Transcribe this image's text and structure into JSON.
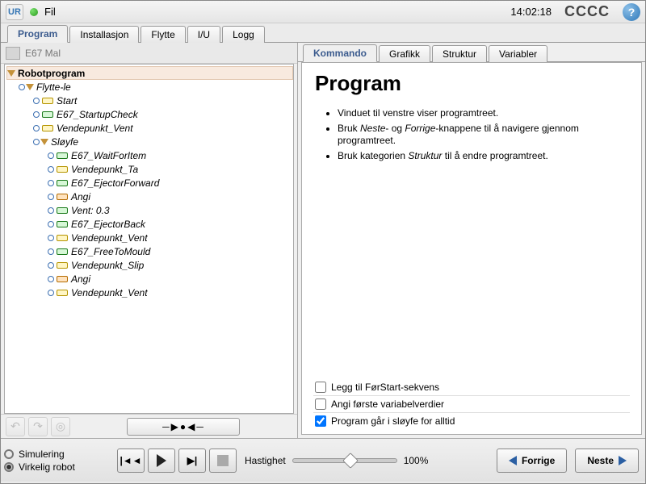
{
  "menubar": {
    "logo_text": "UR",
    "file_menu": "Fil",
    "clock": "14:02:18",
    "cccc": "CCCC",
    "help": "?"
  },
  "main_tabs": [
    {
      "label": "Program",
      "active": true
    },
    {
      "label": "Installasjon",
      "active": false
    },
    {
      "label": "Flytte",
      "active": false
    },
    {
      "label": "I/U",
      "active": false
    },
    {
      "label": "Logg",
      "active": false
    }
  ],
  "file": {
    "name": "E67 Mal"
  },
  "tree": {
    "root": "Robotprogram",
    "nodes": [
      {
        "depth": 1,
        "toggle": true,
        "tri": true,
        "ico": null,
        "label": "Flytte-le"
      },
      {
        "depth": 2,
        "toggle": false,
        "ico": "yellow",
        "label": "Start"
      },
      {
        "depth": 2,
        "toggle": false,
        "ico": "green",
        "label": "E67_StartupCheck"
      },
      {
        "depth": 2,
        "toggle": false,
        "ico": "yellow",
        "label": "Vendepunkt_Vent"
      },
      {
        "depth": 2,
        "toggle": true,
        "tri": true,
        "ico": null,
        "label": "Sløyfe"
      },
      {
        "depth": 3,
        "toggle": false,
        "ico": "green",
        "label": "E67_WaitForItem"
      },
      {
        "depth": 3,
        "toggle": false,
        "ico": "yellow",
        "label": "Vendepunkt_Ta"
      },
      {
        "depth": 3,
        "toggle": false,
        "ico": "green",
        "label": "E67_EjectorForward"
      },
      {
        "depth": 3,
        "toggle": false,
        "ico": "orange",
        "label": "Angi"
      },
      {
        "depth": 3,
        "toggle": false,
        "ico": "green",
        "label": "Vent: 0.3"
      },
      {
        "depth": 3,
        "toggle": false,
        "ico": "green",
        "label": "E67_EjectorBack"
      },
      {
        "depth": 3,
        "toggle": false,
        "ico": "yellow",
        "label": "Vendepunkt_Vent"
      },
      {
        "depth": 3,
        "toggle": false,
        "ico": "green",
        "label": "E67_FreeToMould"
      },
      {
        "depth": 3,
        "toggle": false,
        "ico": "yellow",
        "label": "Vendepunkt_Slip"
      },
      {
        "depth": 3,
        "toggle": false,
        "ico": "orange",
        "label": "Angi"
      },
      {
        "depth": 3,
        "toggle": false,
        "ico": "yellow",
        "label": "Vendepunkt_Vent"
      }
    ]
  },
  "sub_tabs": [
    {
      "label": "Kommando",
      "active": true
    },
    {
      "label": "Grafikk",
      "active": false
    },
    {
      "label": "Struktur",
      "active": false
    },
    {
      "label": "Variabler",
      "active": false
    }
  ],
  "panel": {
    "heading": "Program",
    "hints": [
      "Vinduet til venstre viser programtreet.",
      "Bruk Neste- og Forrige-knappene til å navigere gjennom programtreet.",
      "Bruk kategorien Struktur til å endre programtreet."
    ],
    "checks": [
      {
        "label": "Legg til FørStart-sekvens",
        "checked": false
      },
      {
        "label": "Angi første variabelverdier",
        "checked": false
      },
      {
        "label": "Program går i sløyfe for alltid",
        "checked": true
      }
    ]
  },
  "footer": {
    "sim_label": "Simulering",
    "real_label": "Virkelig robot",
    "speed_label": "Hastighet",
    "speed_value": "100%",
    "speed_fraction": 0.55,
    "prev": "Forrige",
    "next": "Neste"
  }
}
